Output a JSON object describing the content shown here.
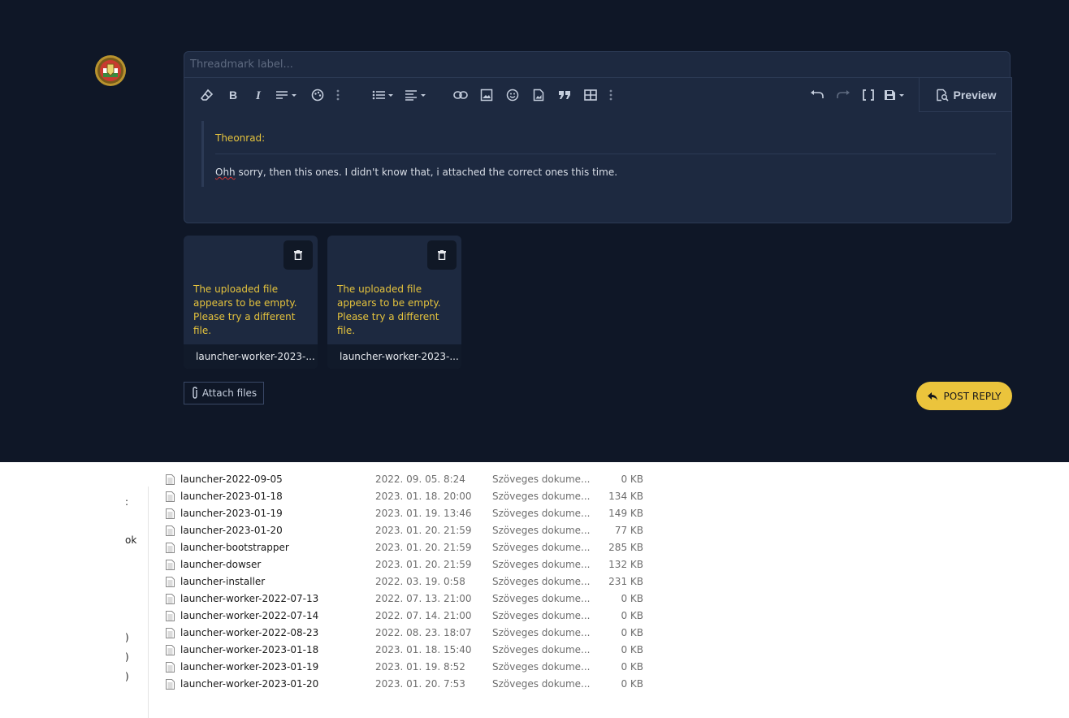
{
  "editor": {
    "threadmark_placeholder": "Threadmark label...",
    "toolbar": {
      "left_tools": [
        "eraser-icon",
        "bold-icon",
        "italic-icon",
        "paragraph-format-icon",
        "text-color-icon",
        "more-vertical-icon",
        "list-icon",
        "align-icon",
        "link-icon",
        "image-icon",
        "emoji-icon",
        "media-icon",
        "quote-icon",
        "table-icon",
        "more-vertical-icon"
      ],
      "right_tools": [
        "undo-icon",
        "redo-icon",
        "bbcode-toggle-icon",
        "save-draft-icon"
      ],
      "preview_label": "Preview"
    },
    "quote": {
      "author": "Theonrad:",
      "misspelled_word": "Ohh",
      "body_rest": " sorry, then this ones. I didn't know that, i attached the correct ones this time."
    }
  },
  "attachments": [
    {
      "error": "The uploaded file appears to be empty. Please try a different file.",
      "name": "launcher-worker-2023-..."
    },
    {
      "error": "The uploaded file appears to be empty. Please try a different file.",
      "name": "launcher-worker-2023-..."
    }
  ],
  "actions": {
    "attach_label": "Attach files",
    "post_reply_label": "POST REPLY"
  },
  "colors": {
    "page_bg": "#0f1727",
    "panel_bg": "#1d2940",
    "accent_yellow": "#ebc43c",
    "error_text": "#e5c33d"
  },
  "explorer": {
    "nav_fragments": [
      ":",
      "ok",
      ")",
      ")",
      ")"
    ],
    "files": [
      {
        "name": "launcher-2022-09-05",
        "date": "2022. 09. 05. 8:24",
        "type": "Szöveges dokume...",
        "size": "0 KB"
      },
      {
        "name": "launcher-2023-01-18",
        "date": "2023. 01. 18. 20:00",
        "type": "Szöveges dokume...",
        "size": "134 KB"
      },
      {
        "name": "launcher-2023-01-19",
        "date": "2023. 01. 19. 13:46",
        "type": "Szöveges dokume...",
        "size": "149 KB"
      },
      {
        "name": "launcher-2023-01-20",
        "date": "2023. 01. 20. 21:59",
        "type": "Szöveges dokume...",
        "size": "77 KB"
      },
      {
        "name": "launcher-bootstrapper",
        "date": "2023. 01. 20. 21:59",
        "type": "Szöveges dokume...",
        "size": "285 KB"
      },
      {
        "name": "launcher-dowser",
        "date": "2023. 01. 20. 21:59",
        "type": "Szöveges dokume...",
        "size": "132 KB"
      },
      {
        "name": "launcher-installer",
        "date": "2022. 03. 19. 0:58",
        "type": "Szöveges dokume...",
        "size": "231 KB"
      },
      {
        "name": "launcher-worker-2022-07-13",
        "date": "2022. 07. 13. 21:00",
        "type": "Szöveges dokume...",
        "size": "0 KB"
      },
      {
        "name": "launcher-worker-2022-07-14",
        "date": "2022. 07. 14. 21:00",
        "type": "Szöveges dokume...",
        "size": "0 KB"
      },
      {
        "name": "launcher-worker-2022-08-23",
        "date": "2022. 08. 23. 18:07",
        "type": "Szöveges dokume...",
        "size": "0 KB"
      },
      {
        "name": "launcher-worker-2023-01-18",
        "date": "2023. 01. 18. 15:40",
        "type": "Szöveges dokume...",
        "size": "0 KB"
      },
      {
        "name": "launcher-worker-2023-01-19",
        "date": "2023. 01. 19. 8:52",
        "type": "Szöveges dokume...",
        "size": "0 KB"
      },
      {
        "name": "launcher-worker-2023-01-20",
        "date": "2023. 01. 20. 7:53",
        "type": "Szöveges dokume...",
        "size": "0 KB"
      }
    ]
  }
}
